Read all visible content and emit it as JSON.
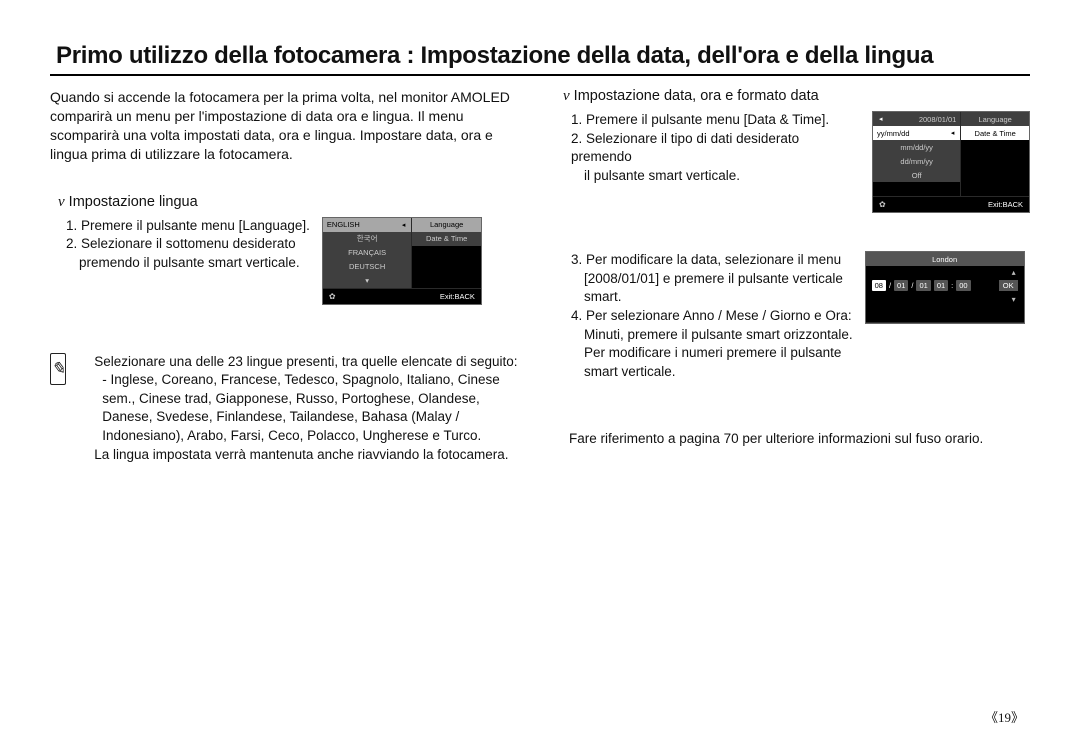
{
  "title": "Primo utilizzo della fotocamera : Impostazione della data, dell'ora e della lingua",
  "intro": "Quando si accende la fotocamera per la prima volta, nel monitor AMOLED comparirà un menu per l'impostazione di data ora e lingua. Il menu scomparirà una volta impostati data, ora e lingua. Impostare data, ora e lingua prima di utilizzare la fotocamera.",
  "left": {
    "subhead": "Impostazione lingua",
    "step1": "1. Premere il pulsante menu [Language].",
    "step2a": "2. Selezionare il sottomenu desiderato",
    "step2b": "premendo il pulsante smart verticale.",
    "screen": {
      "left_items": [
        "ENGLISH",
        "한국어",
        "FRANÇAIS",
        "DEUTSCH"
      ],
      "right_items": [
        "Language",
        "Date & Time"
      ],
      "exit": "Exit:BACK"
    },
    "note_intro": "Selezionare una delle 23 lingue presenti, tra quelle elencate di seguito:",
    "note_list": "- Inglese, Coreano, Francese, Tedesco, Spagnolo, Italiano, Cinese sem., Cinese trad, Giapponese, Russo, Portoghese, Olandese, Danese, Svedese, Finlandese, Tailandese, Bahasa (Malay / Indonesiano), Arabo, Farsi, Ceco, Polacco, Ungherese e Turco.",
    "note_tail": "La lingua impostata verrà mantenuta anche riavviando la fotocamera."
  },
  "right": {
    "subhead": "Impostazione data, ora e formato data",
    "step1": "1. Premere il pulsante menu [Data & Time].",
    "step2a": "2. Selezionare il tipo di dati desiderato premendo",
    "step2b": "il pulsante smart verticale.",
    "screen2": {
      "left_items": [
        "2008/01/01",
        "yy/mm/dd",
        "mm/dd/yy",
        "dd/mm/yy",
        "Off"
      ],
      "right_items": [
        "Language",
        "Date & Time"
      ],
      "exit": "Exit:BACK"
    },
    "step3a": "3. Per modificare la data, selezionare il menu",
    "step3b": "[2008/01/01] e premere il pulsante verticale",
    "step3c": "smart.",
    "step4a": "4. Per selezionare Anno / Mese / Giorno e Ora:",
    "step4b": "Minuti, premere il pulsante smart orizzontale.",
    "step4c": "Per modificare i numeri premere il pulsante",
    "step4d": "smart verticale.",
    "screen3": {
      "city": "London",
      "date": [
        "08",
        "01",
        "01",
        "01",
        "00"
      ],
      "ok": "OK"
    },
    "footnote": "Fare riferimento a pagina 70 per ulteriore informazioni sul fuso orario."
  },
  "pagenum": "19"
}
